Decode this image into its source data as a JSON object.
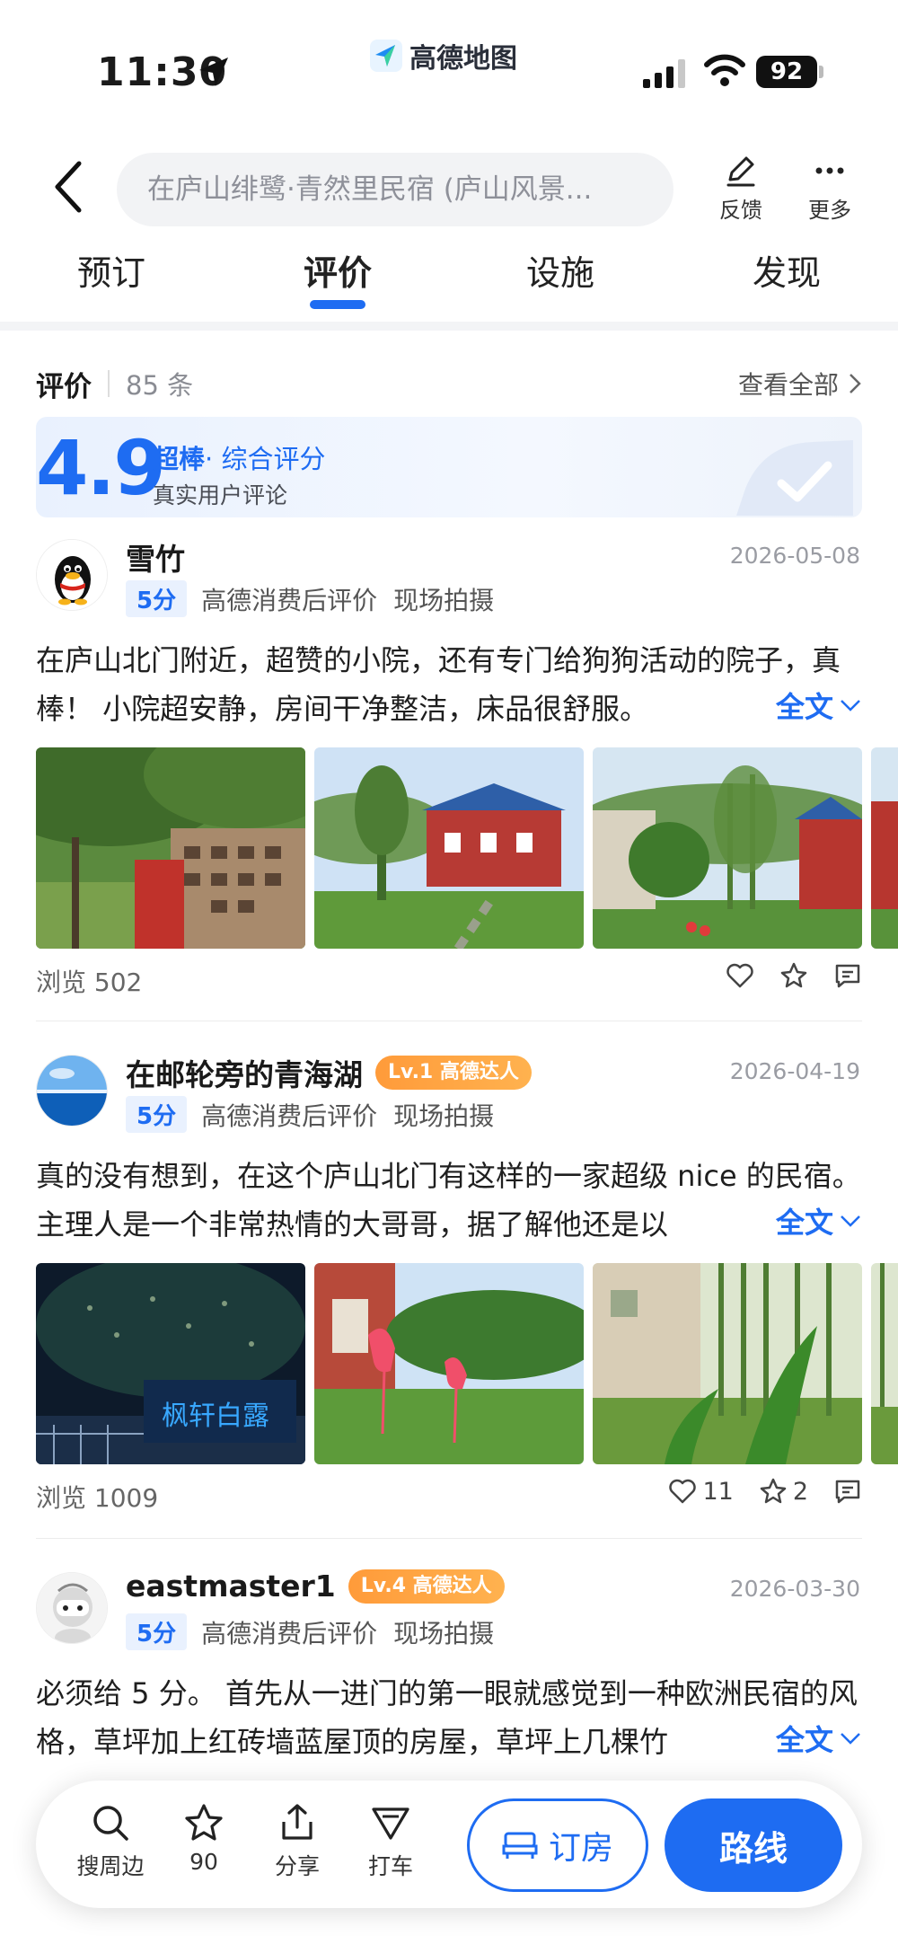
{
  "status_bar": {
    "time": "11:30",
    "app_name": "高德地图",
    "battery": "92"
  },
  "header": {
    "search_text": "在庐山绯鹭·青然里民宿 (庐山风景...",
    "feedback_label": "反馈",
    "more_label": "更多"
  },
  "tabs": [
    {
      "label": "预订"
    },
    {
      "label": "评价",
      "active": true
    },
    {
      "label": "设施"
    },
    {
      "label": "发现"
    }
  ],
  "reviews_header": {
    "title": "评价",
    "count": "85 条",
    "see_all": "查看全部"
  },
  "score": {
    "value": "4.9",
    "grade": "超棒",
    "grade_suffix": "· 综合评分",
    "subtitle": "真实用户评论"
  },
  "reviews": [
    {
      "user": "雪竹",
      "level_badge": "",
      "date": "2026-05-08",
      "points": "5分",
      "tag1": "高德消费后评价",
      "tag2": "现场拍摄",
      "text": "在庐山北门附近，超赞的小院，还有专门给狗狗活动的院子，真棒！ 小院超安静，房间干净整洁，床品很舒服。",
      "more_label": "全文",
      "views": "浏览 502",
      "likes": "",
      "stars": ""
    },
    {
      "user": "在邮轮旁的青海湖",
      "level_badge": "Lv.1 高德达人",
      "date": "2026-04-19",
      "points": "5分",
      "tag1": "高德消费后评价",
      "tag2": "现场拍摄",
      "text": "真的没有想到，在这个庐山北门有这样的一家超级 nice 的民宿。主理人是一个非常热情的大哥哥，据了解他还是以",
      "more_label": "全文",
      "views": "浏览 1009",
      "likes": "11",
      "stars": "2",
      "photo_sign": "枫轩白露"
    },
    {
      "user": "eastmaster1",
      "level_badge": "Lv.4 高德达人",
      "date": "2026-03-30",
      "points": "5分",
      "tag1": "高德消费后评价",
      "tag2": "现场拍摄",
      "text": "必须给 5 分。 首先从一进门的第一眼就感觉到一种欧洲民宿的风格，草坪加上红砖墙蓝屋顶的房屋，草坪上几棵竹",
      "more_label": "全文"
    }
  ],
  "bottom_bar": {
    "search_nearby": "搜周边",
    "favorite_count": "90",
    "share": "分享",
    "taxi": "打车",
    "book_label": "订房",
    "route_label": "路线"
  },
  "colors": {
    "accent": "#1e6cf2",
    "badge_orange": "#ff9b3a",
    "date_gray": "#9a9ca3"
  }
}
